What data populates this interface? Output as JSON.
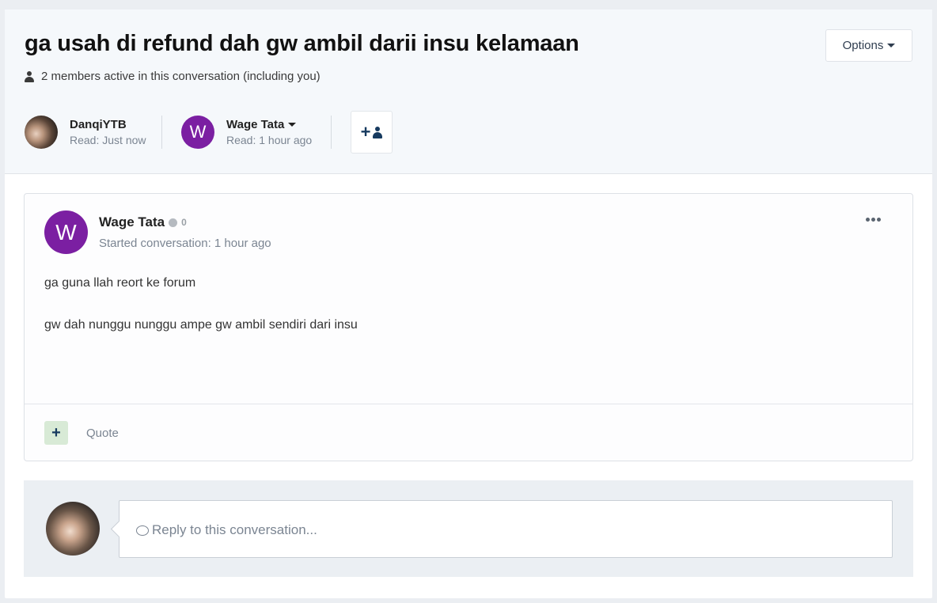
{
  "header": {
    "title": "ga usah di refund dah gw ambil darii insu kelamaan",
    "active_members": "2 members active in this conversation (including you)",
    "options_label": "Options"
  },
  "members": [
    {
      "name": "DanqiYTB",
      "read": "Read: Just now",
      "avatar": "photo"
    },
    {
      "name": "Wage Tata",
      "read": "Read: 1 hour ago",
      "avatar_letter": "W",
      "avatar_color": "#7b1fa2"
    }
  ],
  "post": {
    "author": "Wage Tata",
    "avatar_letter": "W",
    "reputation": "0",
    "meta": "Started conversation: 1 hour ago",
    "body": [
      "ga guna llah reort ke forum",
      "gw dah nunggu nunggu ampe gw ambil sendiri dari insu"
    ],
    "react_label": "+",
    "quote_label": "Quote"
  },
  "reply": {
    "placeholder": "Reply to this conversation..."
  },
  "colors": {
    "accent": "#7b1fa2",
    "dark_blue": "#163a5f",
    "header_bg": "#f5f8fb"
  }
}
